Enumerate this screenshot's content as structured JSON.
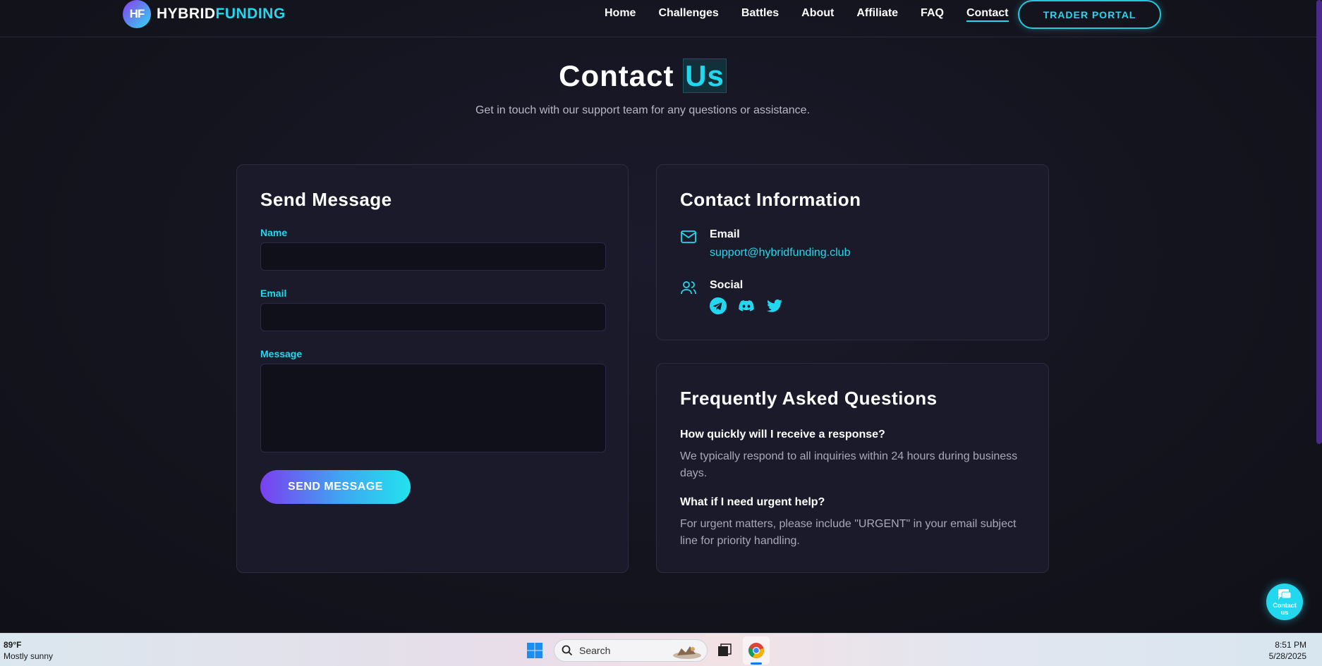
{
  "nav": {
    "logo_badge": "HF",
    "logo_part1": "HYBRID",
    "logo_part2": "FUNDING",
    "links": [
      "Home",
      "Challenges",
      "Battles",
      "About",
      "Affiliate",
      "FAQ",
      "Contact"
    ],
    "active_link": "Contact",
    "portal_button": "TRADER PORTAL"
  },
  "hero": {
    "title_main": "Contact",
    "title_highlight": "Us",
    "subtitle": "Get in touch with our support team for any questions or assistance."
  },
  "send_form": {
    "heading": "Send Message",
    "name_label": "Name",
    "name_value": "",
    "email_label": "Email",
    "email_value": "",
    "message_label": "Message",
    "message_value": "",
    "submit_label": "SEND MESSAGE"
  },
  "contact_info": {
    "heading": "Contact Information",
    "email_title": "Email",
    "email_address": "support@hybridfunding.club",
    "social_title": "Social",
    "social_icons": [
      "telegram-icon",
      "discord-icon",
      "twitter-icon"
    ]
  },
  "faq": {
    "heading": "Frequently Asked Questions",
    "items": [
      {
        "q": "How quickly will I receive a response?",
        "a": "We typically respond to all inquiries within 24 hours during business days."
      },
      {
        "q": "What if I need urgent help?",
        "a": "For urgent matters, please include \"URGENT\" in your email subject line for priority handling."
      }
    ]
  },
  "floating": {
    "line1": "Contact",
    "line2": "us"
  },
  "taskbar": {
    "temperature": "89°F",
    "weather": "Mostly sunny",
    "search_placeholder": "Search",
    "time": "8:51 PM",
    "date": "5/28/2025"
  },
  "colors": {
    "accent": "#22d8ee",
    "purple": "#7a3ff0",
    "background": "#15151f",
    "card": "#1a1a2b"
  }
}
